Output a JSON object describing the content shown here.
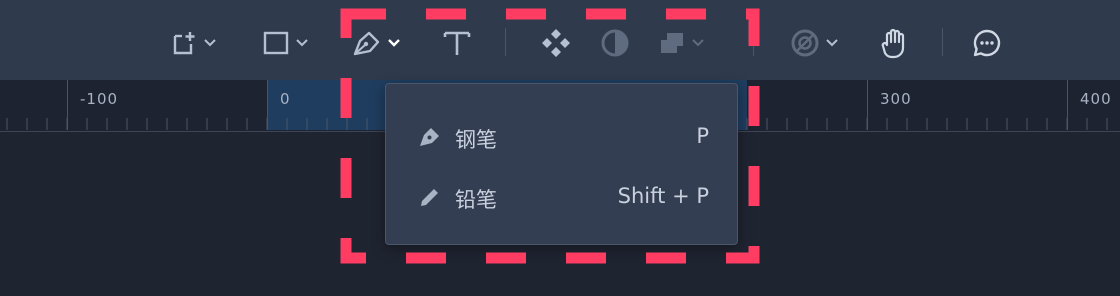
{
  "toolbar": {
    "tools": [
      {
        "name": "add-frame-icon"
      },
      {
        "name": "rectangle-icon"
      },
      {
        "name": "pen-icon"
      },
      {
        "name": "text-icon"
      },
      {
        "name": "component-icon"
      },
      {
        "name": "contrast-icon"
      },
      {
        "name": "boolean-icon"
      },
      {
        "name": "mask-icon"
      },
      {
        "name": "hand-icon"
      },
      {
        "name": "comment-icon"
      }
    ]
  },
  "ruler": {
    "labels": [
      "-100",
      "0",
      "300",
      "400"
    ]
  },
  "pen_menu": {
    "items": [
      {
        "icon": "pen-icon",
        "label": "钢笔",
        "shortcut": "P"
      },
      {
        "icon": "pencil-icon",
        "label": "铅笔",
        "shortcut": "Shift + P"
      }
    ]
  },
  "colors": {
    "toolbar_bg": "#2f3a4d",
    "canvas_bg": "#1f2431",
    "menu_bg": "#333e52",
    "highlight": "#ff3d62"
  }
}
